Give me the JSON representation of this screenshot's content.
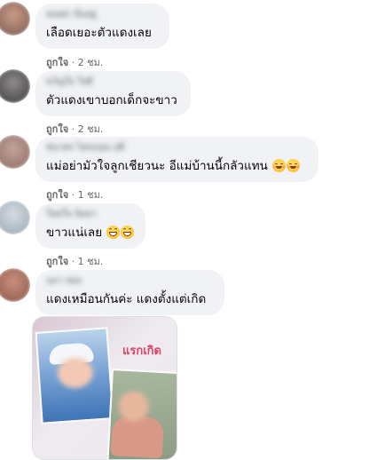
{
  "colors": {
    "bubble_bg": "#f0f2f5",
    "meta_text": "#65676b",
    "photo_label": "#d9456b"
  },
  "comments": [
    {
      "name": "ธณพร นั่นอยู่",
      "text": "เลือดเยอะตัวแดงเลย",
      "like": "ถูกใจ",
      "time": "2 ชม."
    },
    {
      "name": "ขวัญใจ ใจดี",
      "text": "ตัวแดงเขาบอกเด็กจะขาว",
      "like": "ถูกใจ",
      "time": "2 ชม."
    },
    {
      "name": "ชนาพร ไพรอรุณ ฤดี",
      "text": "แม่อย่ามัวใจลูกเชียวนะ อีแม่บ้านนี้กลัวแทน",
      "emojis": [
        "smiling-blush-icon",
        "smiling-blush-icon"
      ],
      "like": "ถูกใจ",
      "time": "1 ชม."
    },
    {
      "name": "ใหม่ใจ นิลลา",
      "text": "ขาวแน่เลย",
      "emojis": [
        "grinning-icon",
        "grinning-icon"
      ],
      "like": "ถูกใจ",
      "time": "1 ชม."
    },
    {
      "name": "นภา ทอง",
      "text": "แดงเหมือนกันค่ะ แดงตั้งแต่เกิด"
    }
  ],
  "photo": {
    "label": "แรกเกิด"
  },
  "meta_separator": "·"
}
